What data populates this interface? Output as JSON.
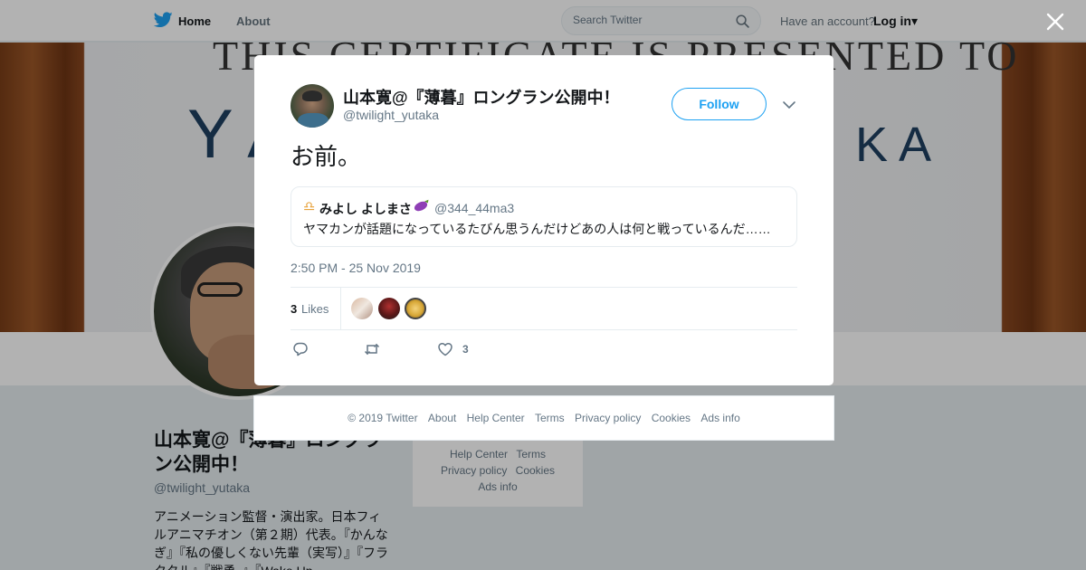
{
  "topbar": {
    "home_label": "Home",
    "about_label": "About",
    "search_placeholder": "Search Twitter",
    "have_account": "Have an account?",
    "login_label": "Log in▾"
  },
  "banner": {
    "certificate_text": "THIS CERTIFICATE IS PRESENTED TO",
    "name_left": "Y A",
    "name_right": "K A"
  },
  "profile": {
    "name": "山本寛@『薄暮』ロングラン公開中！",
    "handle": "@twilight_yutaka",
    "bio": "アニメーション監督・演出家。日本フィルアニマチオン（第２期）代表。『かんなぎ』『私の優しくない先輩（実写）』『フラクタル』『戦勇。』『Wake Up,",
    "mini_footer": [
      "Help Center",
      "Terms",
      "Privacy policy",
      "Cookies",
      "Ads info"
    ]
  },
  "tweet": {
    "author_name": "山本寛@『薄暮』ロングラン公開中！",
    "author_handle": "@twilight_yutaka",
    "follow_label": "Follow",
    "text": "お前。",
    "quote": {
      "emoji_prefix": "♎",
      "name": "みよし よしまさ",
      "emoji_suffix": "eggplant",
      "handle": "@344_44ma3",
      "text": "ヤマカンが話題になっているたびん思うんだけどあの人は何と戦っているんだ……"
    },
    "timestamp": "2:50 PM - 25 Nov 2019",
    "likes_count": "3",
    "likes_label": "Likes",
    "like_action_count": "3"
  },
  "footer": {
    "copyright": "© 2019 Twitter",
    "links": [
      "About",
      "Help Center",
      "Terms",
      "Privacy policy",
      "Cookies",
      "Ads info"
    ]
  },
  "colors": {
    "accent": "#1da1f2",
    "secondary_text": "#657786",
    "border": "#e6ecf0"
  }
}
